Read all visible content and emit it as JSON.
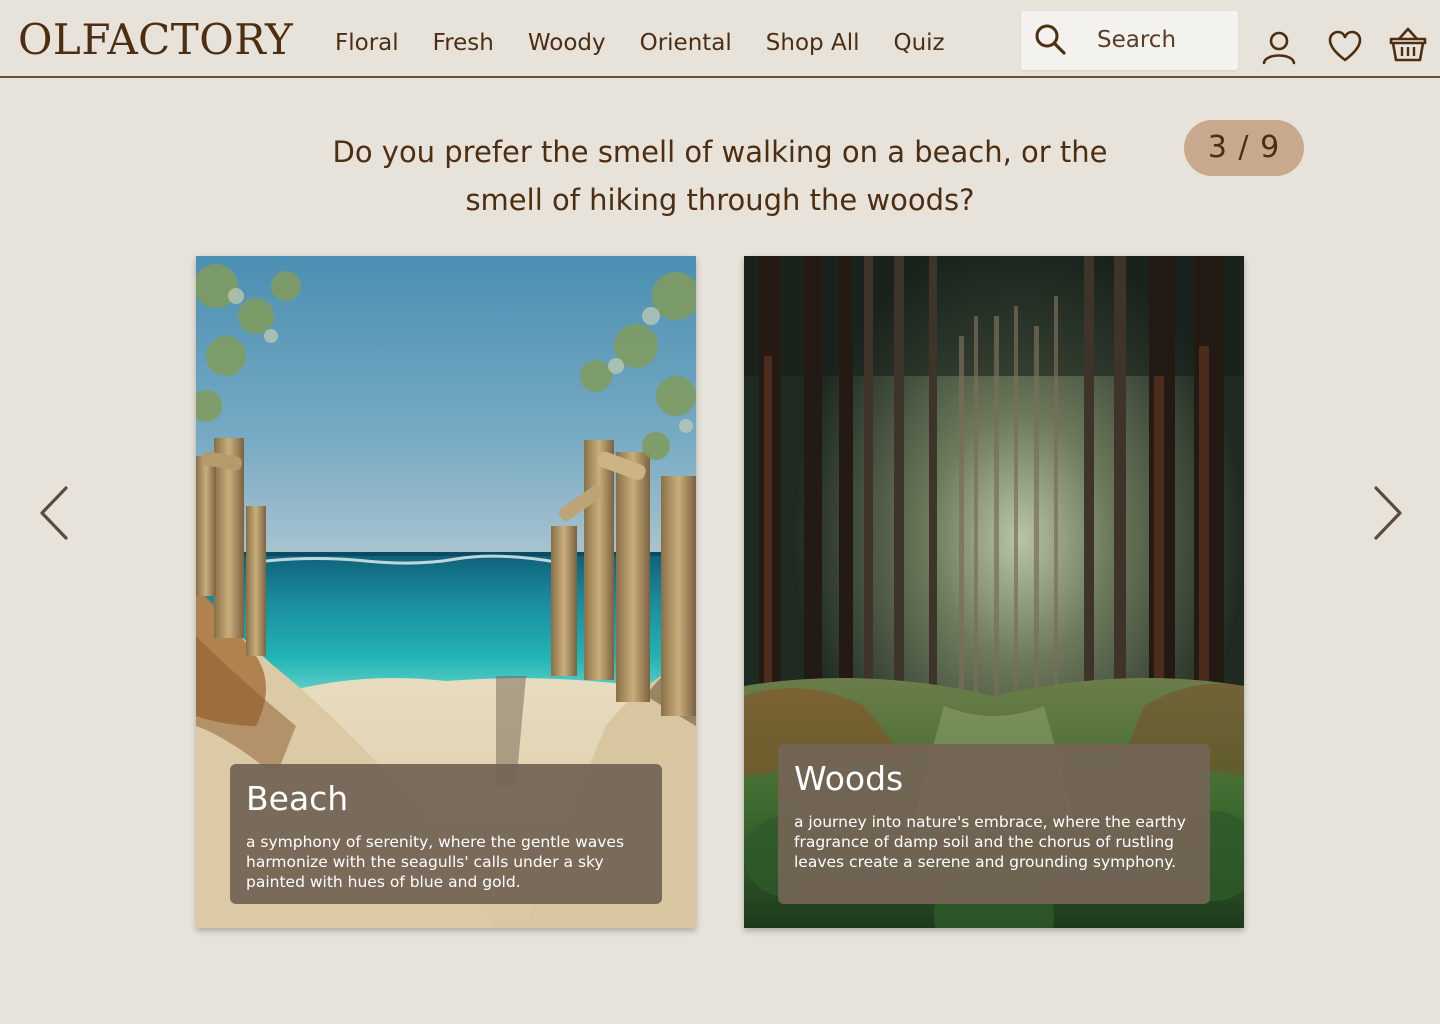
{
  "header": {
    "logo": "OLFACTORY",
    "nav": [
      "Floral",
      "Fresh",
      "Woody",
      "Oriental",
      "Shop All",
      "Quiz"
    ],
    "search_placeholder": "Search",
    "icons": [
      "search-icon",
      "account-icon",
      "heart-icon",
      "basket-icon"
    ]
  },
  "quiz": {
    "question": "Do you prefer the smell of walking on a beach, or the smell of hiking through the woods?",
    "progress": "3 / 9",
    "current": 3,
    "total": 9
  },
  "options": [
    {
      "title": "Beach",
      "description": "a symphony of serenity, where the gentle waves harmonize with the seagulls' calls under a sky painted with hues of blue and gold."
    },
    {
      "title": "Woods",
      "description": "a journey into nature's embrace, where the earthy fragrance of damp soil and the chorus of rustling leaves create a serene and grounding symphony."
    }
  ],
  "colors": {
    "background": "#e7e3da",
    "text": "#4d2e11",
    "badge": "#c9a98e",
    "caption_overlay": "#746455"
  }
}
